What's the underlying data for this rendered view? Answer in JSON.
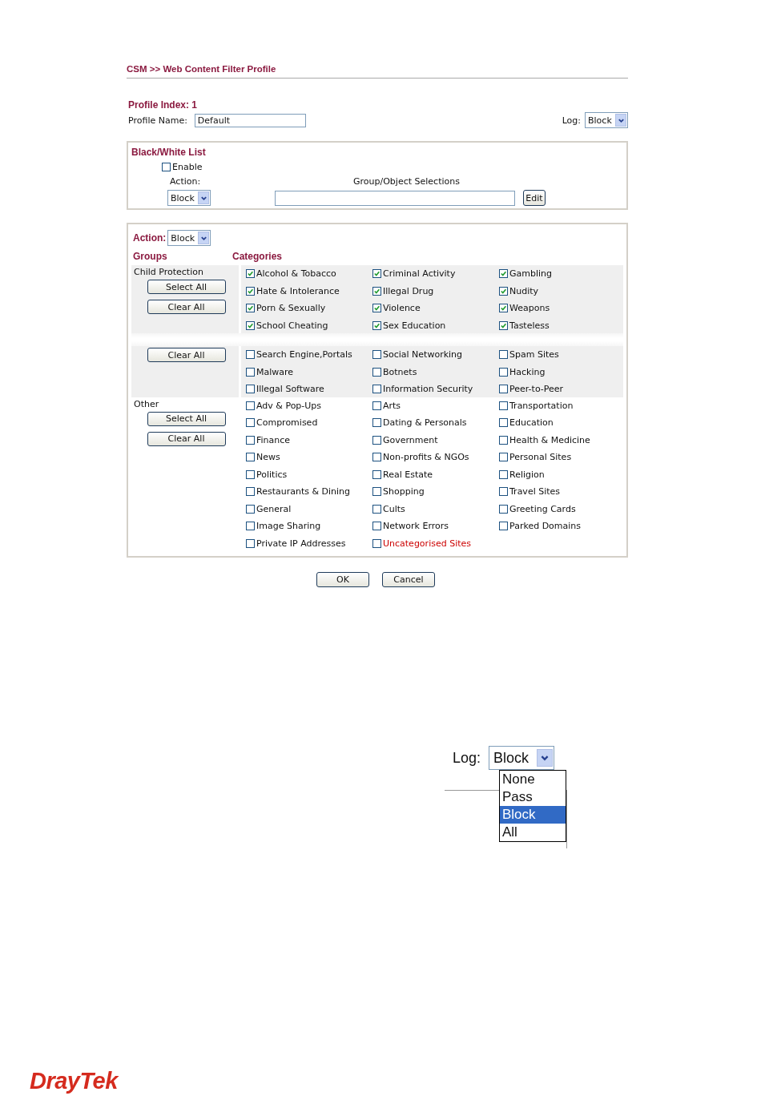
{
  "page_title": "CSM >> Web Content Filter Profile",
  "profile_index": "Profile Index: 1",
  "profile_name": {
    "label": "Profile Name:",
    "value": "Default"
  },
  "log": {
    "label": "Log:",
    "value": "Block"
  },
  "black_white_list": {
    "title": "Black/White List",
    "enable": {
      "label": "Enable",
      "checked": false
    },
    "action_label": "Action:",
    "selections_label": "Group/Object Selections",
    "action_value": "Block",
    "edit_button": "Edit"
  },
  "filter": {
    "action_label": "Action:",
    "action_value": "Block",
    "groups_header": "Groups",
    "categories_header": "Categories",
    "groups": [
      {
        "name": "Child Protection",
        "buttons": [
          "Select All",
          "Clear All"
        ],
        "shaded": true,
        "items": [
          {
            "label": "Alcohol & Tobacco",
            "checked": true
          },
          {
            "label": "Criminal Activity",
            "checked": true
          },
          {
            "label": "Gambling",
            "checked": true
          },
          {
            "label": "Hate & Intolerance",
            "checked": true
          },
          {
            "label": "Illegal Drug",
            "checked": true
          },
          {
            "label": "Nudity",
            "checked": true
          },
          {
            "label": "Porn & Sexually",
            "checked": true
          },
          {
            "label": "Violence",
            "checked": true
          },
          {
            "label": "Weapons",
            "checked": true
          },
          {
            "label": "School Cheating",
            "checked": true
          },
          {
            "label": "Sex Education",
            "checked": true
          },
          {
            "label": "Tasteless",
            "checked": true
          }
        ]
      },
      {
        "buttons": [
          "Clear All"
        ],
        "shaded": true,
        "items": [
          {
            "label": "Search Engine,Portals",
            "checked": false
          },
          {
            "label": "Social Networking",
            "checked": false
          },
          {
            "label": "Spam Sites",
            "checked": false
          },
          {
            "label": "Malware",
            "checked": false
          },
          {
            "label": "Botnets",
            "checked": false
          },
          {
            "label": "Hacking",
            "checked": false
          },
          {
            "label": "Illegal Software",
            "checked": false
          },
          {
            "label": "Information Security",
            "checked": false
          },
          {
            "label": "Peer-to-Peer",
            "checked": false
          }
        ]
      },
      {
        "name": "Other",
        "buttons": [
          "Select All",
          "Clear All"
        ],
        "shaded": false,
        "items": [
          {
            "label": "Adv & Pop-Ups",
            "checked": false
          },
          {
            "label": "Arts",
            "checked": false
          },
          {
            "label": "Transportation",
            "checked": false
          },
          {
            "label": "Compromised",
            "checked": false
          },
          {
            "label": "Dating & Personals",
            "checked": false
          },
          {
            "label": "Education",
            "checked": false
          },
          {
            "label": "Finance",
            "checked": false
          },
          {
            "label": "Government",
            "checked": false
          },
          {
            "label": "Health & Medicine",
            "checked": false
          },
          {
            "label": "News",
            "checked": false
          },
          {
            "label": "Non-profits & NGOs",
            "checked": false
          },
          {
            "label": "Personal Sites",
            "checked": false
          },
          {
            "label": "Politics",
            "checked": false
          },
          {
            "label": "Real Estate",
            "checked": false
          },
          {
            "label": "Religion",
            "checked": false
          },
          {
            "label": "Restaurants & Dining",
            "checked": false
          },
          {
            "label": "Shopping",
            "checked": false
          },
          {
            "label": "Travel Sites",
            "checked": false
          },
          {
            "label": "General",
            "checked": false
          },
          {
            "label": "Cults",
            "checked": false
          },
          {
            "label": "Greeting Cards",
            "checked": false
          },
          {
            "label": "Image Sharing",
            "checked": false
          },
          {
            "label": "Network Errors",
            "checked": false
          },
          {
            "label": "Parked Domains",
            "checked": false
          },
          {
            "label": "Private IP Addresses",
            "checked": false
          },
          {
            "label": "Uncategorised Sites",
            "checked": false,
            "color": "#cc0000"
          }
        ]
      }
    ]
  },
  "buttons": [
    "OK",
    "Cancel"
  ],
  "log_dropdown": {
    "label": "Log:",
    "value": "Block",
    "options": [
      {
        "label": "None",
        "selected": false
      },
      {
        "label": "Pass",
        "selected": false
      },
      {
        "label": "Block",
        "selected": true
      },
      {
        "label": "All",
        "selected": false
      }
    ]
  },
  "logo": "DrayTek"
}
